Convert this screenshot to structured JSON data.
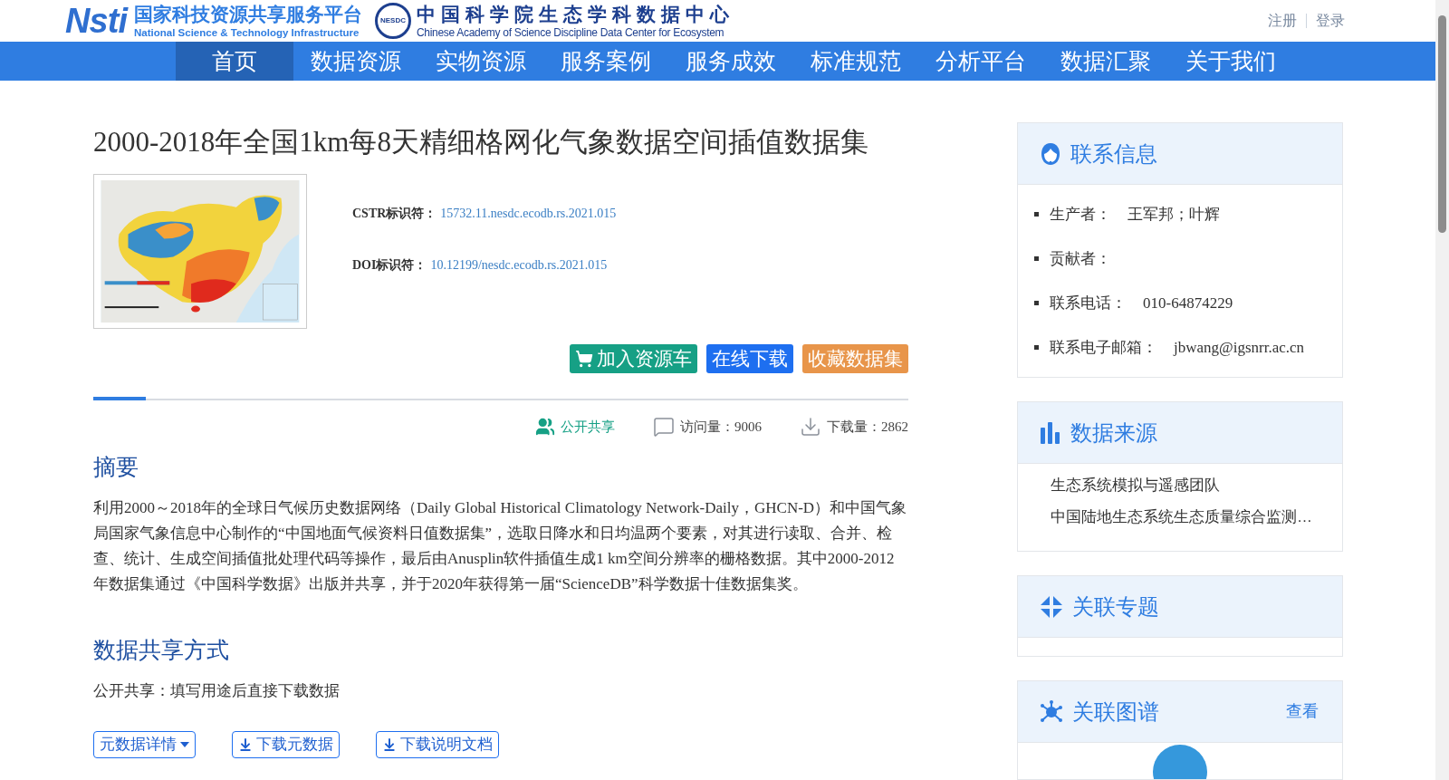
{
  "header": {
    "logo_mark": "Nsti",
    "platform_name": "国家科技资源共享服务平台",
    "platform_subtitle": "National Science & Technology Infrastructure",
    "badge": "NESDC",
    "center_name": "中国科学院生态学科数据中心",
    "center_subtitle": "Chinese Academy of Science Discipline Data Center for Ecosystem",
    "auth_links": [
      "注册",
      "登录"
    ]
  },
  "nav": [
    {
      "label": "首页",
      "selected": true
    },
    {
      "label": "数据资源",
      "selected": false
    },
    {
      "label": "实物资源",
      "selected": false
    },
    {
      "label": "服务案例",
      "selected": false
    },
    {
      "label": "服务成效",
      "selected": false
    },
    {
      "label": "标准规范",
      "selected": false
    },
    {
      "label": "分析平台",
      "selected": false
    },
    {
      "label": "数据汇聚",
      "selected": false
    },
    {
      "label": "关于我们",
      "selected": false
    }
  ],
  "dataset": {
    "title": "2000-2018年全国1km每8天精细格网化气象数据空间插值数据集",
    "identifiers": [
      {
        "label": "CSTR标识符：",
        "value": "15732.11.nesdc.ecodb.rs.2021.015"
      },
      {
        "label": "DOI标识符：",
        "value": "10.12199/nesdc.ecodb.rs.2021.015"
      }
    ],
    "actions": [
      {
        "kind": "cart",
        "label": "加入资源车"
      },
      {
        "kind": "download",
        "label": "在线下载"
      },
      {
        "kind": "favorite",
        "label": "收藏数据集"
      }
    ],
    "stats": [
      {
        "kind": "share",
        "text": "公开共享"
      },
      {
        "kind": "views",
        "text": "访问量：9006"
      },
      {
        "kind": "downloads",
        "text": "下载量：2862"
      }
    ],
    "sections": [
      {
        "heading": "摘要",
        "text": "利用2000～2018年的全球日气候历史数据网络（Daily Global Historical Climatology Network-Daily，GHCN-D）和中国气象局国家气象信息中心制作的“中国地面气候资料日值数据集”，选取日降水和日均温两个要素，对其进行读取、合并、检查、统计、生成空间插值批处理代码等操作，最后由Anusplin软件插值生成1 km空间分辨率的栅格数据。其中2000-2012年数据集通过《中国科学数据》出版并共享，并于2020年获得第一届“ScienceDB”科学数据十佳数据集奖。"
      },
      {
        "heading": "数据共享方式",
        "text": "公开共享：填写用途后直接下载数据"
      }
    ],
    "bottom_buttons": [
      {
        "kind": "dropdown",
        "label": "元数据详情"
      },
      {
        "kind": "download",
        "label": "下载元数据"
      },
      {
        "kind": "download",
        "label": "下载说明文档"
      }
    ]
  },
  "sidebar": [
    {
      "kind": "contact",
      "title": "联系信息",
      "items": [
        {
          "label": "生产者：",
          "value": "王军邦；叶辉"
        },
        {
          "label": "贡献者："
        },
        {
          "label": "联系电话：",
          "value": "010-64874229"
        },
        {
          "label": "联系电子邮箱：",
          "value": "jbwang@igsnrr.ac.cn"
        }
      ]
    },
    {
      "kind": "source",
      "title": "数据来源",
      "items": [
        {
          "label": "生态系统模拟与遥感团队"
        },
        {
          "label": "中国陆地生态系统生态质量综合监测…"
        }
      ]
    },
    {
      "kind": "topic",
      "title": "关联专题"
    },
    {
      "kind": "graph",
      "title": "关联图谱",
      "link": "查看"
    }
  ]
}
